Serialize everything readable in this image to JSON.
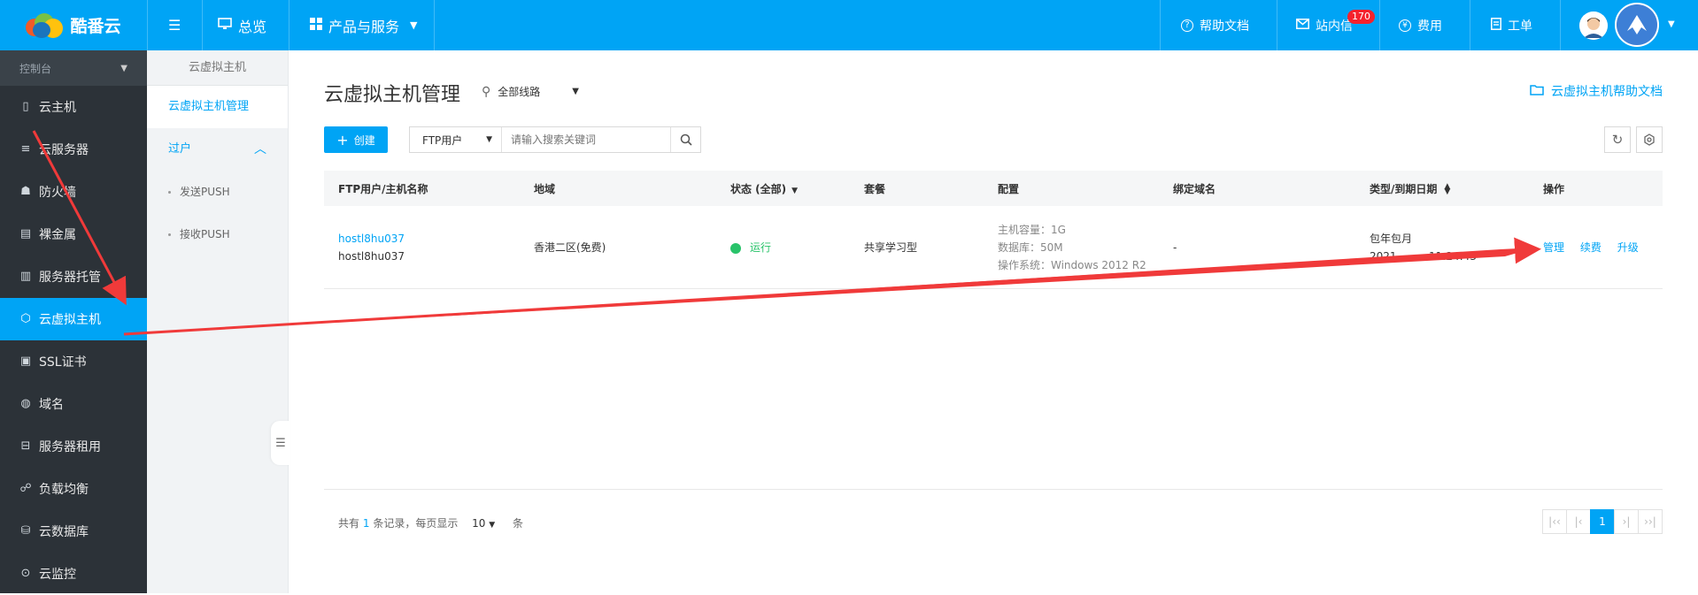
{
  "brand": {
    "name": "酷番云"
  },
  "topbar": {
    "overview": "总览",
    "products": "产品与服务",
    "help_docs": "帮助文档",
    "messages": "站内信",
    "messages_count": "170",
    "billing": "费用",
    "tickets": "工单"
  },
  "sidebar": {
    "header": "控制台",
    "items": [
      {
        "label": "云主机",
        "icon": "server-icon"
      },
      {
        "label": "云服务器",
        "icon": "rack-icon"
      },
      {
        "label": "防火墙",
        "icon": "firewall-icon"
      },
      {
        "label": "裸金属",
        "icon": "grid-icon"
      },
      {
        "label": "服务器托管",
        "icon": "hosting-icon"
      },
      {
        "label": "云虚拟主机",
        "icon": "cube-icon",
        "active": true
      },
      {
        "label": "SSL证书",
        "icon": "certificate-icon"
      },
      {
        "label": "域名",
        "icon": "globe-icon"
      },
      {
        "label": "服务器租用",
        "icon": "lease-icon"
      },
      {
        "label": "负载均衡",
        "icon": "balance-icon"
      },
      {
        "label": "云数据库",
        "icon": "database-icon"
      },
      {
        "label": "云监控",
        "icon": "monitor-icon"
      }
    ]
  },
  "subnav": {
    "title": "云虚拟主机",
    "manage": "云虚拟主机管理",
    "transfer": "过户",
    "send_push": "发送PUSH",
    "receive_push": "接收PUSH"
  },
  "main": {
    "title": "云虚拟主机管理",
    "line_filter": "全部线路",
    "help_link": "云虚拟主机帮助文档",
    "create": "创建",
    "search_type": "FTP用户",
    "search_placeholder": "请输入搜索关键词"
  },
  "table": {
    "headers": [
      "FTP用户/主机名称",
      "地域",
      "状态 (全部)",
      "套餐",
      "配置",
      "绑定域名",
      "类型/到期日期",
      "操作"
    ],
    "rows": [
      {
        "ftp_user": "hostl8hu037",
        "host_name": "hostl8hu037",
        "region": "香港二区(免费)",
        "status": "运行",
        "plan": "共享学习型",
        "cfg_capacity": "主机容量：1G",
        "cfg_db": "数据库：50M",
        "cfg_os": "操作系统：Windows 2012 R2",
        "domain": "-",
        "type": "包年包月",
        "expire": "2021-…-… 11:24:43",
        "op_manage": "管理",
        "op_renew": "续费",
        "op_upgrade": "升级"
      }
    ]
  },
  "pagination": {
    "prefix": "共有",
    "total": "1",
    "middle": "条记录，每页显示",
    "page_size": "10",
    "suffix": "条",
    "current": "1"
  },
  "colors": {
    "primary": "#00a4f5",
    "sidebar": "#2c3238",
    "success": "#29c36a",
    "annotation": "#f03a3a"
  }
}
